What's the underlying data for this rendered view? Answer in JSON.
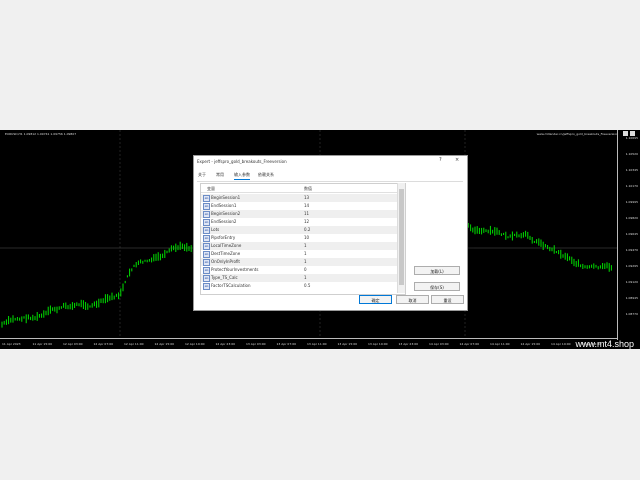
{
  "chart": {
    "symbol_info": "EURUSD,H1  1.09812 1.09741 1.09756 1.09807",
    "indicator_title": "www.mtlander.cn/jeffspro_gold_breakouts_Freeversion",
    "price_labels": [
      "1.10695",
      "1.10520",
      "1.10345",
      "1.10170",
      "1.09995",
      "1.09820",
      "1.09645",
      "1.09470",
      "1.09295",
      "1.09120",
      "1.08945",
      "1.08770"
    ],
    "time_labels": [
      "11 Apr 2023",
      "11 Apr 15:00",
      "12 Apr 03:00",
      "12 Apr 07:00",
      "12 Apr 11:00",
      "12 Apr 15:00",
      "12 Apr 19:00",
      "12 Apr 23:00",
      "13 Apr 03:00",
      "13 Apr 07:00",
      "13 Apr 11:00",
      "13 Apr 15:00",
      "13 Apr 19:00",
      "13 Apr 23:00",
      "14 Apr 03:00",
      "14 Apr 07:00",
      "14 Apr 11:00",
      "14 Apr 15:00",
      "14 Apr 19:00",
      "17 Apr 02:00"
    ],
    "watermark": "www.mt4.shop",
    "candle_color": "#00e000",
    "background": "#000000"
  },
  "dialog": {
    "title": "Expert - jeffspro_gold_breakouts_Freeversion",
    "help": "?",
    "close": "×",
    "tabs": [
      "关于",
      "常用",
      "输入参数",
      "依赖关系"
    ],
    "active_tab": "输入参数",
    "columns": {
      "name": "变量",
      "value": "数值"
    },
    "params": [
      {
        "icon": "ab",
        "name": "BeginSession1",
        "value": "13"
      },
      {
        "icon": "ab",
        "name": "EndSession1",
        "value": "14"
      },
      {
        "icon": "ab",
        "name": "BeginSession2",
        "value": "11"
      },
      {
        "icon": "ab",
        "name": "EndSession2",
        "value": "12"
      },
      {
        "icon": "ab",
        "name": "Lots",
        "value": "0.2"
      },
      {
        "icon": "ab",
        "name": "PipsforEntry",
        "value": "10"
      },
      {
        "icon": "ab",
        "name": "LocalTimeZone",
        "value": "1"
      },
      {
        "icon": "ab",
        "name": "DestTimeZone",
        "value": "1"
      },
      {
        "icon": "ab",
        "name": "OnOnlyInProfit",
        "value": "1"
      },
      {
        "icon": "ab",
        "name": "ProtectYourInvestments",
        "value": "0"
      },
      {
        "icon": "ab",
        "name": "Type_TS_Calc",
        "value": "1"
      },
      {
        "icon": "ab",
        "name": "FactorTSCalculation",
        "value": "0.5"
      }
    ],
    "buttons": {
      "load": "加载(L)",
      "save": "保存(S)",
      "ok": "确定",
      "cancel": "取消",
      "reset": "重设"
    }
  }
}
